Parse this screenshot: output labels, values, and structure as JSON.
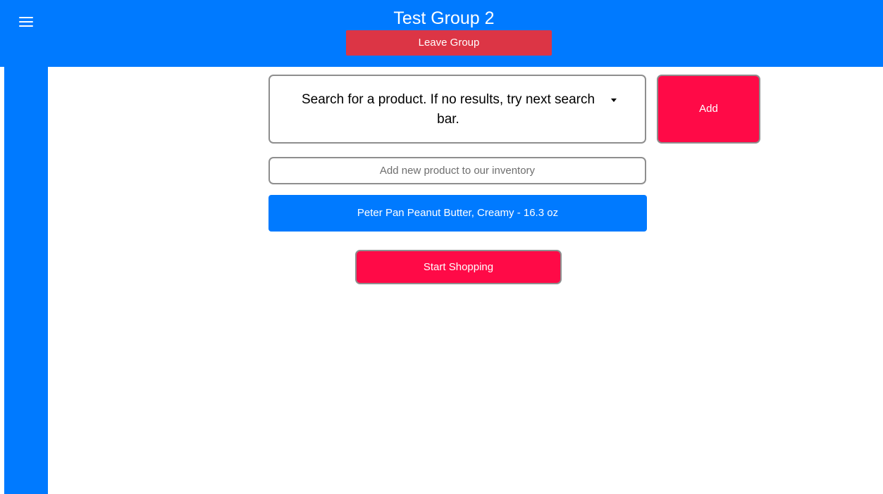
{
  "header": {
    "title": "Test Group 2",
    "leave_label": "Leave Group",
    "menu_icon": "hamburger-menu-icon"
  },
  "main": {
    "product_search": {
      "text": "Search for a product. If no results, try next search bar.",
      "dropdown_icon": "caret-down-icon"
    },
    "add_label": "Add",
    "new_product": {
      "placeholder": "Add new product to our inventory",
      "value": ""
    },
    "products": [
      {
        "label": "Peter Pan Peanut Butter, Creamy - 16.3 oz"
      }
    ],
    "start_label": "Start Shopping"
  },
  "colors": {
    "primary": "#007aff",
    "danger": "#dc3545",
    "accent": "#ff0a47",
    "border": "#8e8e8e"
  }
}
